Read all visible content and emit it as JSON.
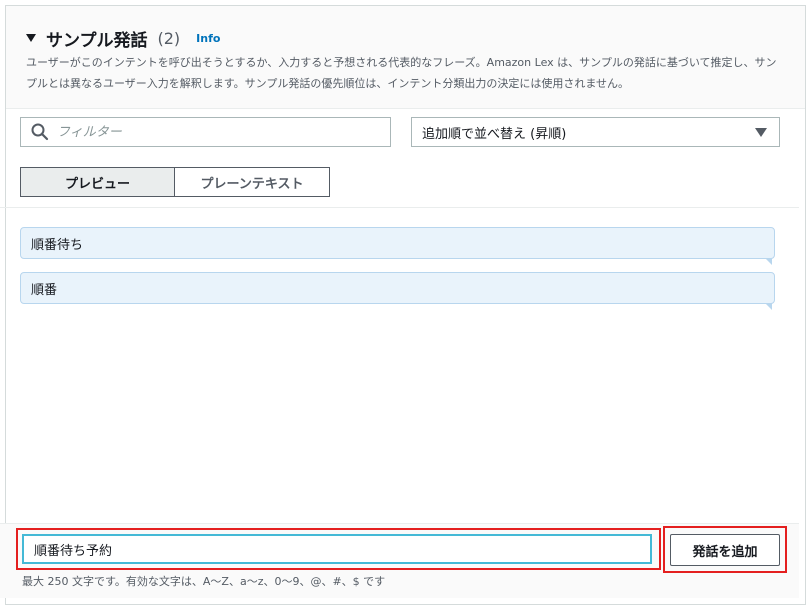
{
  "section": {
    "title": "サンプル発話",
    "count": "(2)",
    "info": "Info",
    "description": "ユーザーがこのインテントを呼び出そうとするか、入力すると予想される代表的なフレーズ。Amazon Lex は、サンプルの発話に基づいて推定し、サンプルとは異なるユーザー入力を解釈します。サンプル発話の優先順位は、インテント分類出力の決定には使用されません。"
  },
  "filter": {
    "placeholder": "フィルター"
  },
  "sort": {
    "selected": "追加順で並べ替え (昇順)"
  },
  "view_toggle": {
    "preview": "プレビュー",
    "plain_text": "プレーンテキスト",
    "active": "preview"
  },
  "utterances": [
    {
      "text": "順番待ち"
    },
    {
      "text": "順番"
    }
  ],
  "new_utterance": {
    "value": "順番待ち予約"
  },
  "add_button": {
    "label": "発話を追加"
  },
  "hint": "最大 250 文字です。有効な文字は、A〜Z、a〜z、0〜9、@、#、$ です",
  "colors": {
    "accent": "#0073bb",
    "highlight": "#e41f1f",
    "focus": "#44b9d6",
    "bubble": "#e9f3fb"
  },
  "icons": {
    "filter": "search-icon",
    "sort": "dropdown-caret-icon",
    "section": "caret-down-icon"
  }
}
